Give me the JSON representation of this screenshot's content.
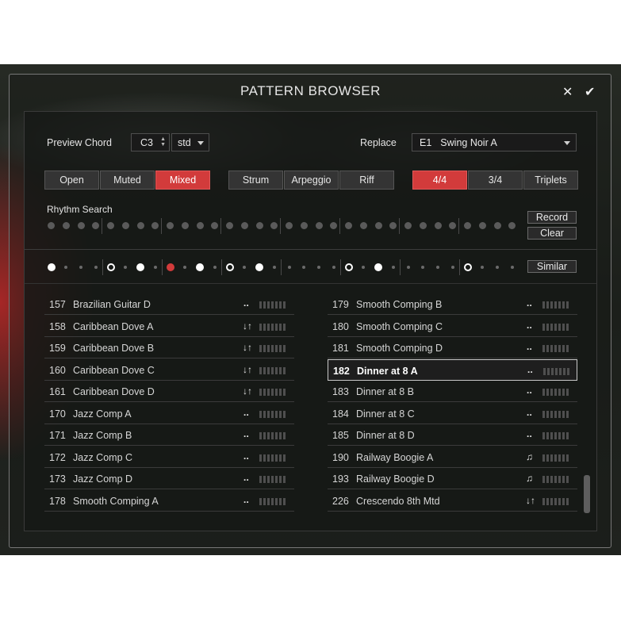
{
  "window": {
    "title": "PATTERN BROWSER",
    "close_icon": "✕",
    "confirm_icon": "✔"
  },
  "preview_chord": {
    "label": "Preview Chord",
    "note": "C3",
    "type": "std"
  },
  "replace": {
    "label": "Replace",
    "key": "E1",
    "pattern": "Swing Noir A"
  },
  "voicing": {
    "options": [
      "Open",
      "Muted",
      "Mixed"
    ],
    "selected": "Mixed"
  },
  "style": {
    "options": [
      "Strum",
      "Arpeggio",
      "Riff"
    ]
  },
  "meter": {
    "options": [
      "4/4",
      "3/4",
      "Triplets"
    ],
    "selected": "4/4"
  },
  "rhythm_search": {
    "label": "Rhythm Search",
    "record": "Record",
    "clear": "Clear",
    "steps": 32
  },
  "similar_button": "Similar",
  "pattern_steps": [
    "filled",
    "s",
    "s",
    "s",
    "open",
    "s",
    "filled",
    "s",
    "red",
    "s",
    "filled",
    "s",
    "open",
    "s",
    "filled",
    "s",
    "s",
    "s",
    "s",
    "s",
    "open",
    "s",
    "filled",
    "s",
    "s",
    "s",
    "s",
    "s",
    "open",
    "s",
    "s",
    "s"
  ],
  "list_left": [
    {
      "num": "157",
      "name": "Brazilian Guitar D",
      "icon": "dash"
    },
    {
      "num": "158",
      "name": "Caribbean Dove A",
      "icon": "arrows"
    },
    {
      "num": "159",
      "name": "Caribbean Dove B",
      "icon": "arrows"
    },
    {
      "num": "160",
      "name": "Caribbean Dove C",
      "icon": "arrows"
    },
    {
      "num": "161",
      "name": "Caribbean Dove D",
      "icon": "arrows"
    },
    {
      "num": "170",
      "name": "Jazz Comp A",
      "icon": "dash"
    },
    {
      "num": "171",
      "name": "Jazz Comp B",
      "icon": "dash"
    },
    {
      "num": "172",
      "name": "Jazz Comp C",
      "icon": "dash"
    },
    {
      "num": "173",
      "name": "Jazz Comp D",
      "icon": "dash"
    },
    {
      "num": "178",
      "name": "Smooth Comping A",
      "icon": "dash"
    }
  ],
  "list_right": [
    {
      "num": "179",
      "name": "Smooth Comping B",
      "icon": "dash"
    },
    {
      "num": "180",
      "name": "Smooth Comping C",
      "icon": "dash"
    },
    {
      "num": "181",
      "name": "Smooth Comping D",
      "icon": "dash"
    },
    {
      "num": "182",
      "name": "Dinner at 8 A",
      "icon": "dash",
      "selected": true
    },
    {
      "num": "183",
      "name": "Dinner at 8 B",
      "icon": "dash"
    },
    {
      "num": "184",
      "name": "Dinner at 8 C",
      "icon": "dash"
    },
    {
      "num": "185",
      "name": "Dinner at 8 D",
      "icon": "dash"
    },
    {
      "num": "190",
      "name": "Railway Boogie A",
      "icon": "note"
    },
    {
      "num": "193",
      "name": "Railway Boogie D",
      "icon": "note"
    },
    {
      "num": "226",
      "name": "Crescendo 8th Mtd",
      "icon": "arrows"
    }
  ],
  "icons": {
    "dash": "⠤",
    "arrows": "↓↑",
    "note": "♫"
  },
  "colors": {
    "accent": "#d23b3b"
  }
}
